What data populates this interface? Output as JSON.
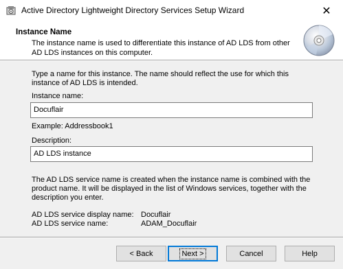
{
  "window": {
    "title": "Active Directory Lightweight Directory Services Setup Wizard",
    "close_glyph": "✕"
  },
  "header": {
    "title": "Instance Name",
    "description": "The instance name is used to differentiate this instance of AD LDS from other AD LDS instances on this computer."
  },
  "content": {
    "intro": "Type a name for this instance. The name should reflect the use for which this instance of AD LDS is intended.",
    "instance_name_label": "Instance name:",
    "instance_name_value": "Docuflair",
    "example": "Example: Addressbook1",
    "description_label": "Description:",
    "description_value": "AD LDS instance",
    "info": "The AD LDS service name is created when the instance name is combined with the product name. It will be displayed in the list of Windows services, together with the description you enter.",
    "display_name_label": "AD LDS service display name:",
    "display_name_value": "Docuflair",
    "service_name_label": "AD LDS service name:",
    "service_name_value": "ADAM_Docuflair"
  },
  "buttons": {
    "back": "< Back",
    "next": "Next >",
    "cancel": "Cancel",
    "help": "Help"
  }
}
